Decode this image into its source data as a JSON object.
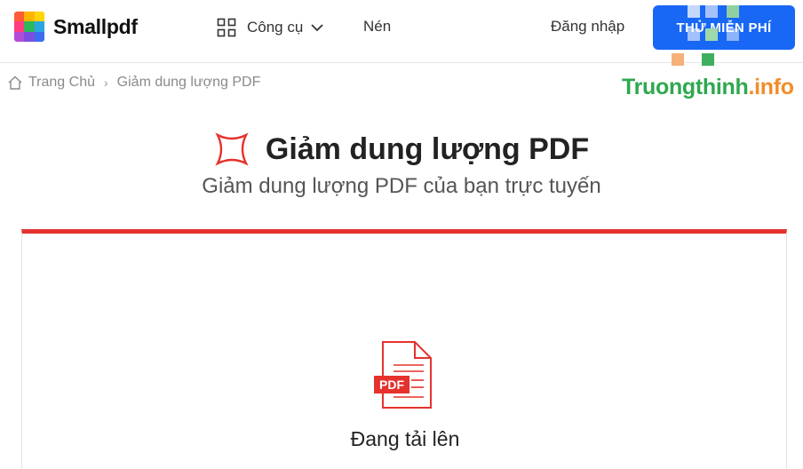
{
  "header": {
    "logo_text": "Smallpdf",
    "tools_label": "Công cụ",
    "compress_label": "Nén",
    "login_label": "Đăng nhập",
    "trial_button": "THỬ MIỄN PHÍ"
  },
  "breadcrumb": {
    "home": "Trang Chủ",
    "separator": "›",
    "current": "Giảm dung lượng PDF"
  },
  "watermark": {
    "green": "Truongthinh",
    "orange": ".info"
  },
  "hero": {
    "title": "Giảm dung lượng PDF",
    "subtitle": "Giảm dung lượng PDF của bạn trực tuyến"
  },
  "upload": {
    "file_badge": "PDF",
    "status": "Đang tải lên"
  },
  "colors": {
    "accent_red": "#e5322d",
    "primary_blue": "#1967f5",
    "watermark_green": "#2fa84f",
    "watermark_orange": "#f28c28"
  },
  "icons": [
    "smallpdf-logo-icon",
    "grid-icon",
    "chevron-down-icon",
    "home-icon",
    "compress-icon",
    "pdf-file-icon"
  ]
}
